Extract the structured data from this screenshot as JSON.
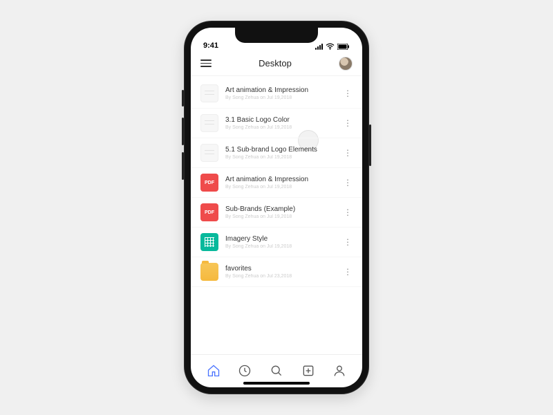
{
  "status": {
    "time": "9:41"
  },
  "header": {
    "title": "Desktop"
  },
  "files": [
    {
      "type": "doc",
      "name": "Art animation & Impression",
      "sub": "By Song Zehua on Jul 19,2018"
    },
    {
      "type": "doc",
      "name": "3.1 Basic Logo Color",
      "sub": "By Song Zehua on Jul 19,2018"
    },
    {
      "type": "doc",
      "name": "5.1 Sub-brand Logo Elements",
      "sub": "By Song Zehua on Jul 19,2018"
    },
    {
      "type": "pdf",
      "name": "Art animation & Impression",
      "sub": "By Song Zehua on Jul 19,2018",
      "badge": "PDF"
    },
    {
      "type": "pdf",
      "name": "Sub-Brands (Example)",
      "sub": "By Song Zehua on Jul 19,2018",
      "badge": "PDF"
    },
    {
      "type": "sheet",
      "name": "Imagery Style",
      "sub": "By Song Zehua on Jul 19,2018"
    },
    {
      "type": "folder",
      "name": "favorites",
      "sub": "By Song Zehua on Jul 23,2018"
    }
  ],
  "tabs": [
    "home",
    "recent",
    "search",
    "add",
    "profile"
  ]
}
